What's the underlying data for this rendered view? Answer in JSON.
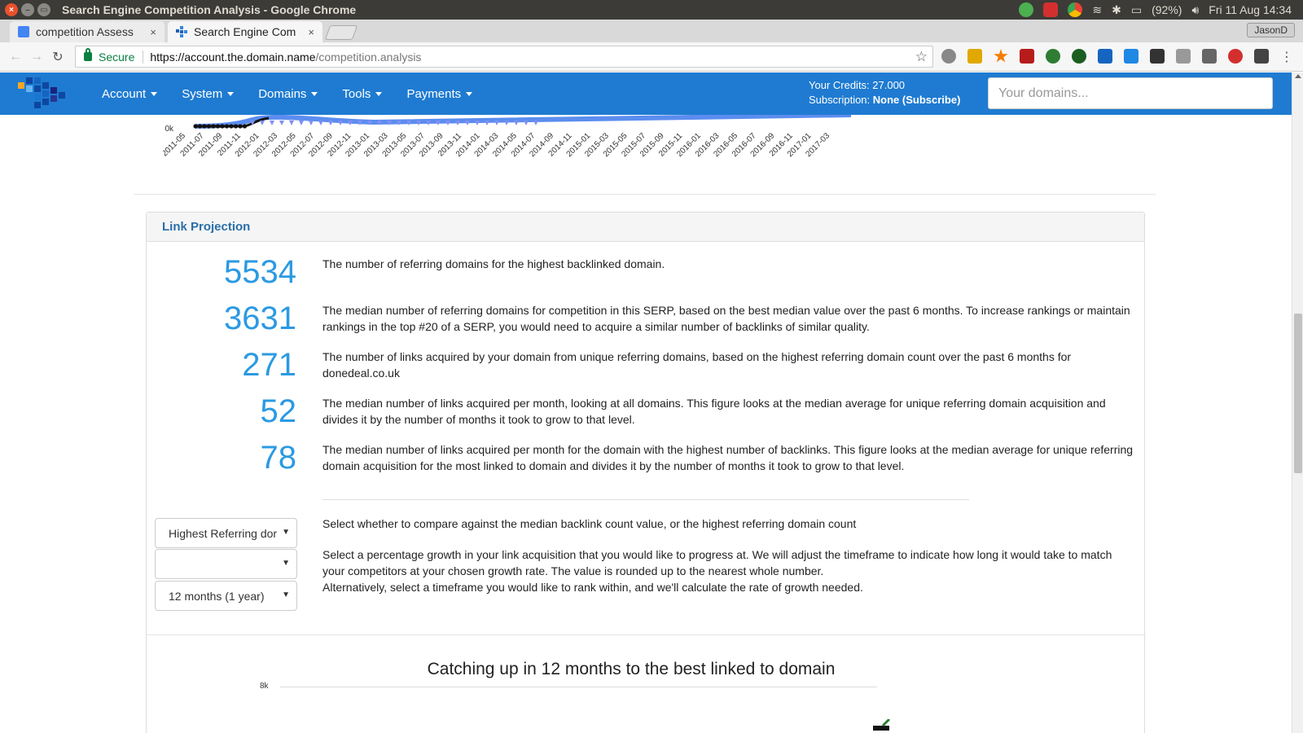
{
  "os": {
    "window_title": "Search Engine Competition Analysis - Google Chrome",
    "battery": "(92%)",
    "datetime": "Fri 11 Aug 14:34"
  },
  "browser": {
    "tabs": [
      {
        "label": "competition Assess",
        "close": "×"
      },
      {
        "label": "Search Engine Com",
        "close": "×"
      }
    ],
    "profile": "JasonD",
    "secure_label": "Secure",
    "url_base": "https://account.the.domain.name",
    "url_path": "/competition.analysis"
  },
  "navbar": {
    "items": [
      {
        "label": "Account"
      },
      {
        "label": "System"
      },
      {
        "label": "Domains"
      },
      {
        "label": "Tools"
      },
      {
        "label": "Payments"
      }
    ],
    "credits_label": "Your Credits: 27.000",
    "subscription_prefix": "Subscription:",
    "subscription_value": "None (Subscribe)",
    "search_placeholder": "Your domains...",
    "brand_color": "#1f7bd1"
  },
  "top_chart": {
    "y_tick": "0k",
    "x_ticks": [
      "2011-05",
      "2011-07",
      "2011-09",
      "2011-11",
      "2012-01",
      "2012-03",
      "2012-05",
      "2012-07",
      "2012-09",
      "2012-11",
      "2013-01",
      "2013-03",
      "2013-05",
      "2013-07",
      "2013-09",
      "2013-11",
      "2014-01",
      "2014-03",
      "2014-05",
      "2014-07",
      "2014-09",
      "2014-11",
      "2015-01",
      "2015-03",
      "2015-05",
      "2015-07",
      "2015-09",
      "2015-11",
      "2016-01",
      "2016-03",
      "2016-05",
      "2016-07",
      "2016-09",
      "2016-11",
      "2017-01",
      "2017-03"
    ]
  },
  "panel": {
    "title": "Link Projection",
    "stats": [
      {
        "value": "5534",
        "text": "The number of referring domains for the highest backlinked domain."
      },
      {
        "value": "3631",
        "text": "The median number of referring domains for competition in this SERP, based on the best median value over the past 6 months. To increase rankings or maintain rankings in the top #20 of a SERP, you would need to acquire a similar number of backlinks of similar quality."
      },
      {
        "value": "271",
        "text": "The number of links acquired by your domain from unique referring domains, based on the highest referring domain count over the past 6 months for donedeal.co.uk"
      },
      {
        "value": "52",
        "text": "The median number of links acquired per month, looking at all domains. This figure looks at the median average for unique referring domain acquisition and divides it by the number of months it took to grow to that level."
      },
      {
        "value": "78",
        "text": "The median number of links acquired per month for the domain with the highest number of backlinks. This figure looks at the median average for unique referring domain acquisition for the most linked to domain and divides it by the number of months it took to grow to that level."
      }
    ],
    "controls": {
      "compare_select": "Highest Referring dor",
      "growth_select": "",
      "timeframe_select": "12 months (1 year)",
      "compare_desc": "Select whether to compare against the median backlink count value, or the highest referring domain count",
      "growth_desc": "Select a percentage growth in your link acquisition that you would like to progress at. We will adjust the timeframe to indicate how long it would take to match your competitors at your chosen growth rate. The value is rounded up to the nearest whole number.",
      "alt_desc": "Alternatively, select a timeframe you would like to rank within, and we'll calculate the rate of growth needed."
    },
    "bottom_chart": {
      "title": "Catching up in 12 months to the best linked to domain",
      "y_tick": "8k"
    },
    "number_color": "#2b9ae2"
  }
}
